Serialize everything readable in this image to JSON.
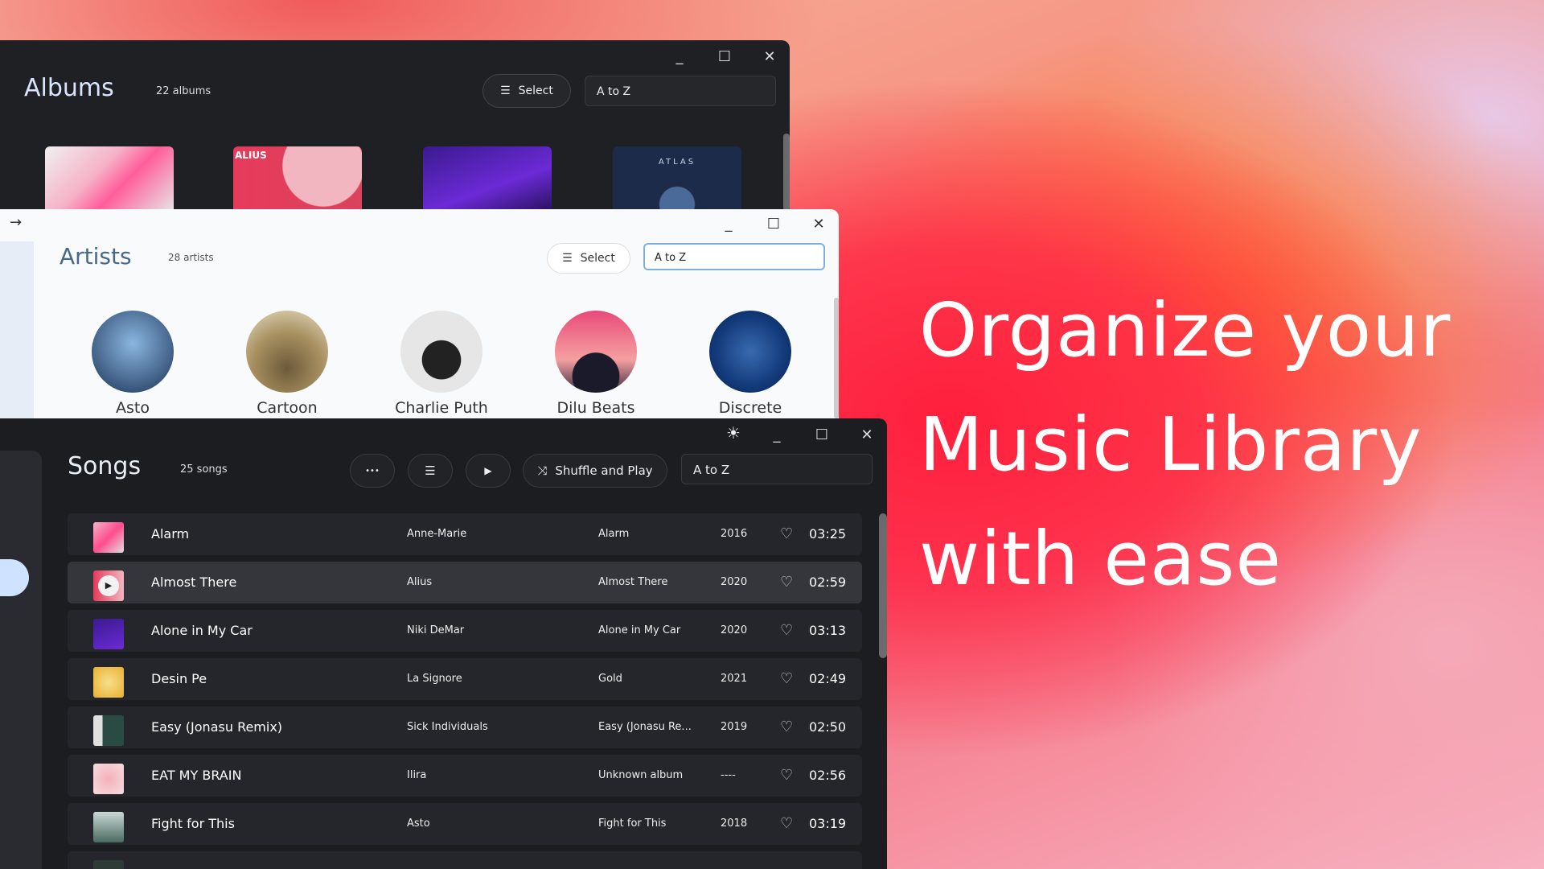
{
  "headline": [
    "Organize your",
    "Music Library",
    "with ease"
  ],
  "albums": {
    "title": "Albums",
    "count": "22 albums",
    "select_label": "Select",
    "sort": "A to Z",
    "cover_text": [
      "ALIUS",
      "ATLAS"
    ]
  },
  "artists": {
    "title": "Artists",
    "count": "28 artists",
    "select_label": "Select",
    "sort": "A to Z",
    "items": [
      {
        "name": "Asto"
      },
      {
        "name": "Cartoon"
      },
      {
        "name": "Charlie Puth"
      },
      {
        "name": "Dilu Beats"
      },
      {
        "name": "Discrete"
      }
    ]
  },
  "songs": {
    "title": "Songs",
    "count": "25 songs",
    "shuffle_label": "Shuffle and Play",
    "sort": "A to Z",
    "rows": [
      {
        "title": "Alarm",
        "artist": "Anne-Marie",
        "album": "Alarm",
        "year": "2016",
        "duration": "03:25"
      },
      {
        "title": "Almost There",
        "artist": "Alius",
        "album": "Almost There",
        "year": "2020",
        "duration": "02:59"
      },
      {
        "title": "Alone in My Car",
        "artist": "Niki DeMar",
        "album": "Alone in My Car",
        "year": "2020",
        "duration": "03:13"
      },
      {
        "title": "Desin Pe",
        "artist": "La Signore",
        "album": "Gold",
        "year": "2021",
        "duration": "02:49"
      },
      {
        "title": "Easy (Jonasu Remix)",
        "artist": "Sick Individuals",
        "album": "Easy (Jonasu Re...",
        "year": "2019",
        "duration": "02:50"
      },
      {
        "title": "EAT MY BRAIN",
        "artist": "Ilira",
        "album": "Unknown album",
        "year": "----",
        "duration": "02:56"
      },
      {
        "title": "Fight for This",
        "artist": "Asto",
        "album": "Fight for This",
        "year": "2018",
        "duration": "03:19"
      }
    ]
  },
  "window_controls": {
    "minimize": "_",
    "maximize": "☐",
    "close": "✕"
  },
  "icons": {
    "back": "→",
    "sun": "☀",
    "more": "•••",
    "select": "☰",
    "play": "▶",
    "shuffle": "⤨",
    "heart": "♡"
  },
  "colors": {
    "accent": "#cfe2ff",
    "dark_bg": "#1c1d21",
    "light_bg": "#f9fafc"
  }
}
